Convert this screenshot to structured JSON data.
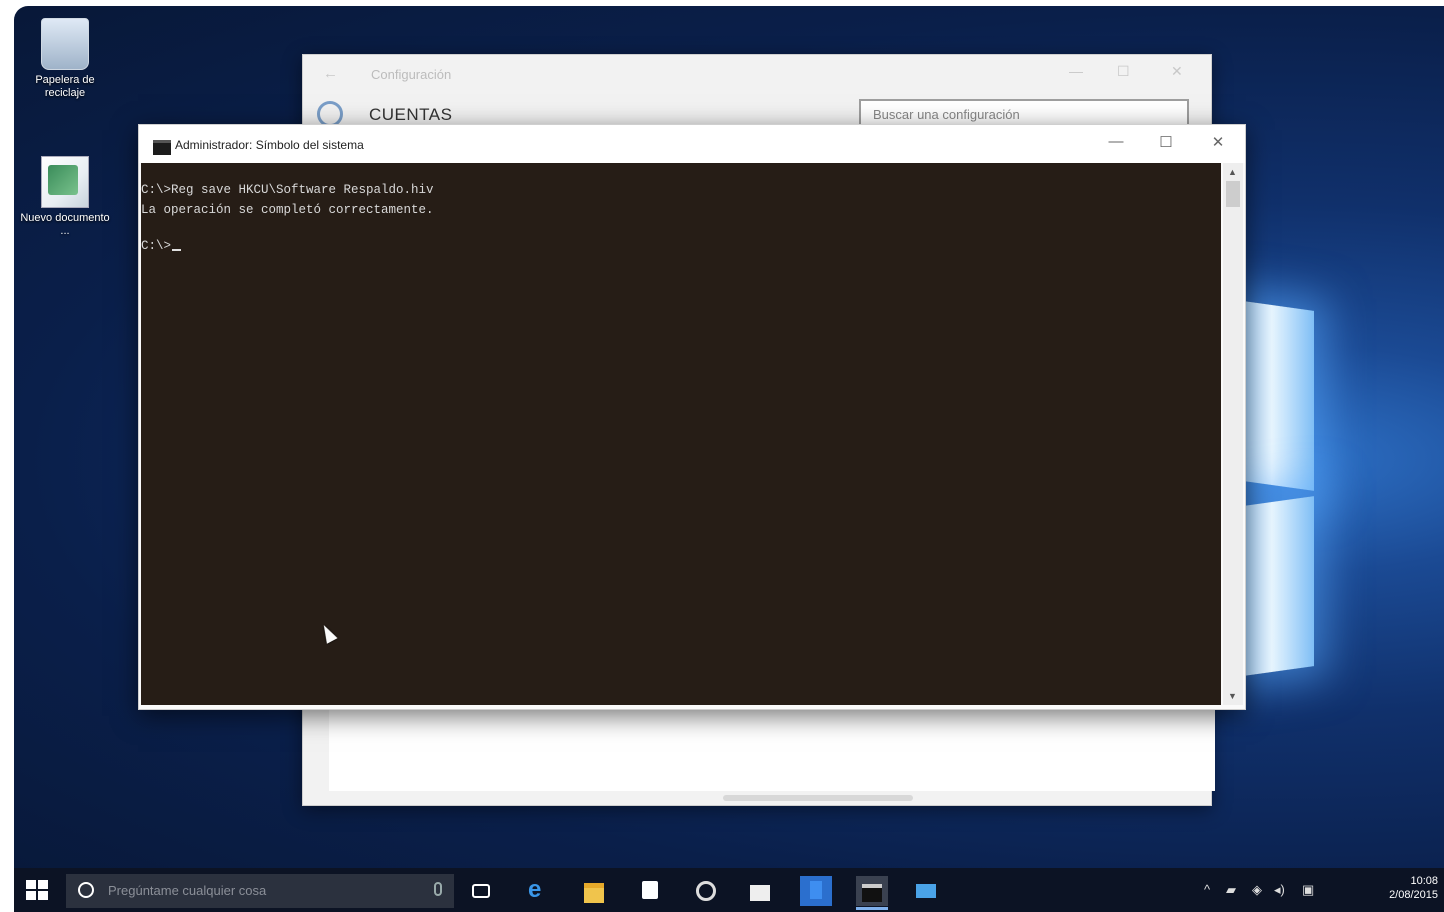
{
  "desktop": {
    "icons": [
      {
        "label": "Papelera de reciclaje"
      },
      {
        "label": "Nuevo documento ..."
      }
    ]
  },
  "settings_window": {
    "title": "Configuración",
    "header": "CUENTAS",
    "search_placeholder": "Buscar una configuración"
  },
  "cmd_window": {
    "title": "Administrador: Símbolo del sistema",
    "lines": [
      "C:\\>Reg save HKCU\\Software Respaldo.hiv",
      "La operación se completó correctamente.",
      "",
      "C:\\>"
    ]
  },
  "taskbar": {
    "search_placeholder": "Pregúntame cualquier cosa",
    "clock_time": "10:08",
    "clock_date": "2/08/2015"
  }
}
